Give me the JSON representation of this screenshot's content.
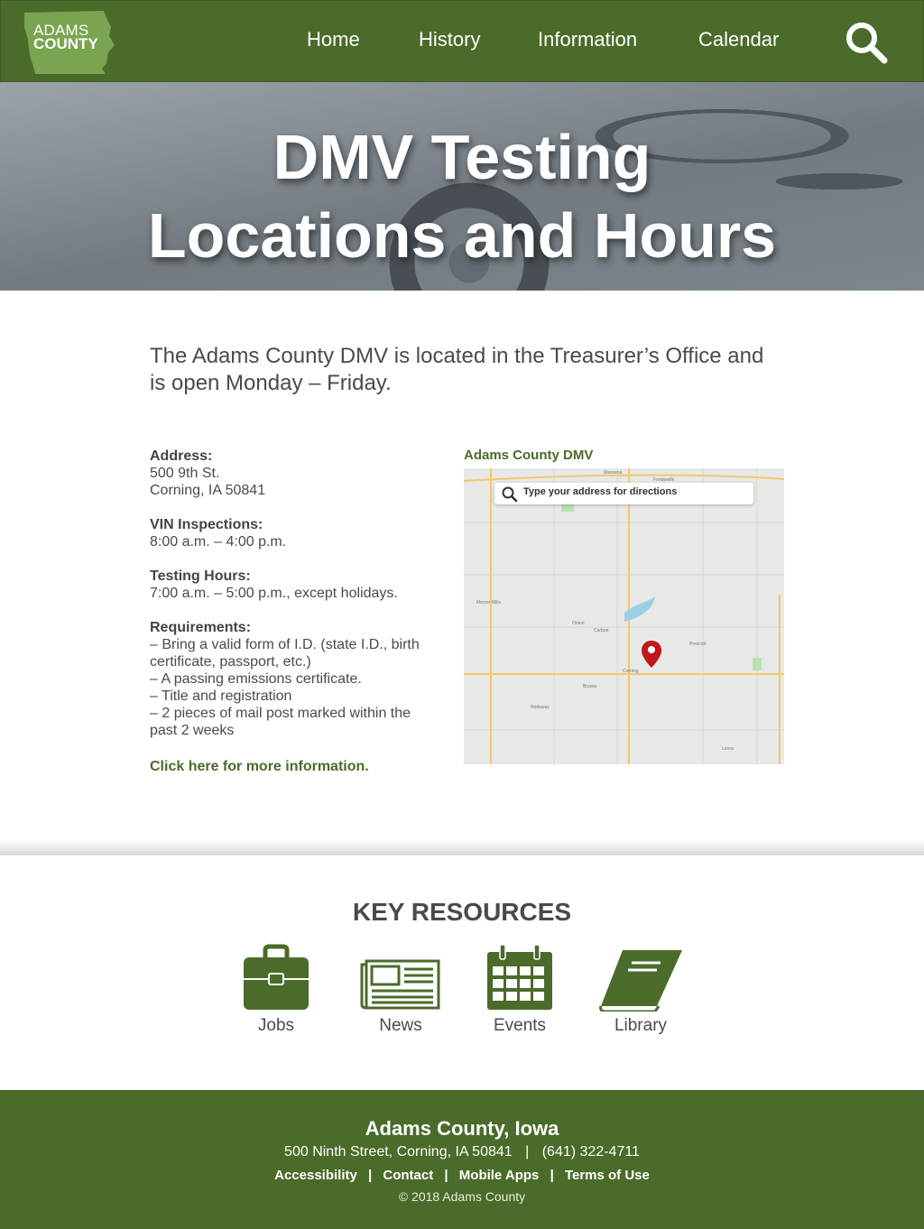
{
  "header": {
    "logo": {
      "line1": "ADAMS",
      "line2": "COUNTY"
    },
    "nav": [
      "Home",
      "History",
      "Information",
      "Calendar"
    ],
    "search_icon": "search-icon"
  },
  "hero": {
    "title_line1": "DMV Testing",
    "title_line2": "Locations and Hours"
  },
  "intro": "The Adams County DMV is located in the Treasurer’s Office and is open Monday – Friday.",
  "info": {
    "address_label": "Address:",
    "address_line1": "500 9th St.",
    "address_line2": "Corning, IA 50841",
    "vin_label": "VIN Inspections:",
    "vin_hours": "8:00 a.m. – 4:00 p.m.",
    "testing_label": "Testing Hours:",
    "testing_hours": "7:00 a.m. – 5:00 p.m., except holidays.",
    "req_label": "Requirements:",
    "requirements": [
      "– Bring a valid form of I.D. (state I.D., birth certificate, passport, etc.)",
      "– A passing emissions certificate.",
      "– Title and registration",
      "– 2 pieces of mail post marked within the past 2 weeks"
    ],
    "more_link": "Click here for more information."
  },
  "map": {
    "title": "Adams County DMV",
    "search_placeholder": "Type your address for directions",
    "places": [
      "Massena",
      "Fontanelle",
      "Nodaway",
      "Carbon",
      "Corning",
      "Prescott",
      "Lenox",
      "Brooks",
      "Mercer Mills",
      "Orient"
    ],
    "pin_color": "#c0161d"
  },
  "key_resources": {
    "title": "KEY RESOURCES",
    "items": [
      {
        "label": "Jobs",
        "icon": "briefcase-icon"
      },
      {
        "label": "News",
        "icon": "newspaper-icon"
      },
      {
        "label": "Events",
        "icon": "calendar-icon"
      },
      {
        "label": "Library",
        "icon": "book-icon"
      }
    ]
  },
  "footer": {
    "title": "Adams County, Iowa",
    "address": "500 Ninth Street, Corning, IA 50841",
    "phone": "(641) 322-4711",
    "addr_sep": "|",
    "links": [
      "Accessibility",
      "Contact",
      "Mobile Apps",
      "Terms of Use"
    ],
    "copyright": "© 2018 Adams County"
  },
  "colors": {
    "brand_green": "#4a6b2a",
    "logo_green": "#7aa450",
    "text_gray": "#4a4a4a"
  }
}
